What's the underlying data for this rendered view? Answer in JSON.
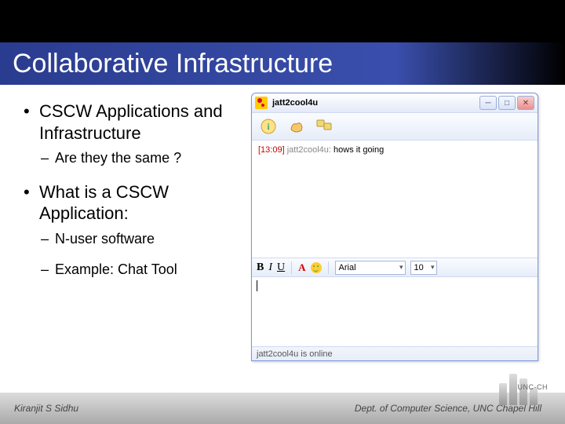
{
  "slide": {
    "title": "Collaborative Infrastructure",
    "bullets": {
      "b1": "CSCW Applications and Infrastructure",
      "b1a": "Are they the same ?",
      "b2": "What is a CSCW Application:",
      "b2a": "N-user software",
      "b2b": "Example: Chat Tool"
    }
  },
  "chat": {
    "title": "jatt2cool4u",
    "timestamp": "[13:09]",
    "sender": "jatt2cool4u:",
    "message": "hows it going",
    "font": "Arial",
    "fontsize": "10",
    "status": "jatt2cool4u is online"
  },
  "footer": {
    "author": "Kiranjit S Sidhu",
    "dept": "Dept. of Computer Science, UNC Chapel Hill",
    "logo": "UNC-CH"
  }
}
